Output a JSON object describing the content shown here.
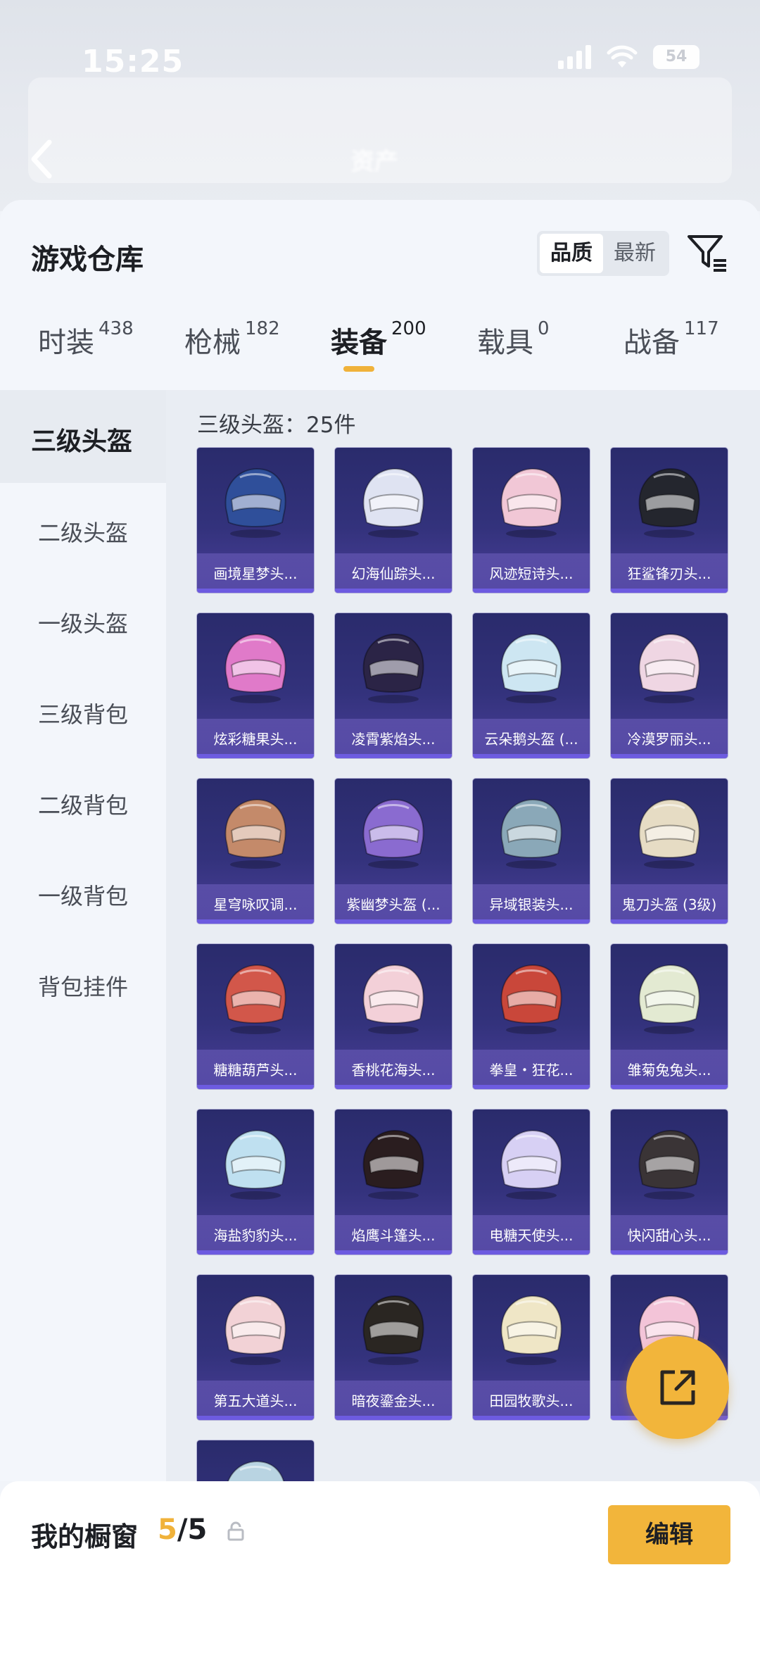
{
  "status_bar": {
    "time": "15:25",
    "battery": "54"
  },
  "backdrop": {
    "ghost_text_1": "资产"
  },
  "panel": {
    "title": "游戏仓库",
    "sort_options": [
      {
        "label": "品质",
        "active": true
      },
      {
        "label": "最新",
        "active": false
      }
    ],
    "filter_icon": "filter-funnel-icon"
  },
  "tabs": [
    {
      "label": "时装",
      "count": "438",
      "active": false
    },
    {
      "label": "枪械",
      "count": "182",
      "active": false
    },
    {
      "label": "装备",
      "count": "200",
      "active": true
    },
    {
      "label": "载具",
      "count": "0",
      "active": false
    },
    {
      "label": "战备",
      "count": "117",
      "active": false
    }
  ],
  "sidebar": {
    "items": [
      {
        "label": "三级头盔",
        "active": true
      },
      {
        "label": "二级头盔",
        "active": false
      },
      {
        "label": "一级头盔",
        "active": false
      },
      {
        "label": "三级背包",
        "active": false
      },
      {
        "label": "二级背包",
        "active": false
      },
      {
        "label": "一级背包",
        "active": false
      },
      {
        "label": "背包挂件",
        "active": false
      }
    ]
  },
  "section": {
    "title": "三级头盔：25件"
  },
  "items": [
    {
      "name": "画境星梦头...",
      "color": "#2f4f9a"
    },
    {
      "name": "幻海仙踪头...",
      "color": "#dfe3f2"
    },
    {
      "name": "风迹短诗头...",
      "color": "#f1c7d6"
    },
    {
      "name": "狂鲨锋刃头...",
      "color": "#24262e"
    },
    {
      "name": "炫彩糖果头...",
      "color": "#e07ac9"
    },
    {
      "name": "凌霄紫焰头...",
      "color": "#2b2446"
    },
    {
      "name": "云朵鹅头盔 (...",
      "color": "#cde6f2"
    },
    {
      "name": "冷漠罗丽头...",
      "color": "#efd6e3"
    },
    {
      "name": "星穹咏叹调...",
      "color": "#c48a6a"
    },
    {
      "name": "紫幽梦头盔 (...",
      "color": "#8a6bd0"
    },
    {
      "name": "异域银装头...",
      "color": "#8aa8b8"
    },
    {
      "name": "鬼刀头盔 (3级)",
      "color": "#e6dcc4"
    },
    {
      "name": "糖糖葫芦头...",
      "color": "#d2574a"
    },
    {
      "name": "香桃花海头...",
      "color": "#f3d0d8"
    },
    {
      "name": "拳皇・狂花...",
      "color": "#c9473a"
    },
    {
      "name": "雏菊兔兔头...",
      "color": "#e3ead2"
    },
    {
      "name": "海盐豹豹头...",
      "color": "#bfe0f0"
    },
    {
      "name": "焰鹰斗篷头...",
      "color": "#2a1d1f"
    },
    {
      "name": "电糖天使头...",
      "color": "#d7d0f4"
    },
    {
      "name": "快闪甜心头...",
      "color": "#3a3436"
    },
    {
      "name": "第五大道头...",
      "color": "#f2d2d6"
    },
    {
      "name": "暗夜鎏金头...",
      "color": "#2a2622"
    },
    {
      "name": "田园牧歌头...",
      "color": "#efe6c6"
    },
    {
      "name": "",
      "color": "#f3c4d8"
    },
    {
      "name": "",
      "color": "#b9d4e2"
    }
  ],
  "share_button": {
    "icon": "share-icon"
  },
  "bottom_bar": {
    "title": "我的橱窗",
    "current": "5",
    "separator": "/",
    "total": "5",
    "edit_label": "编辑",
    "accent": "#f2b53b"
  }
}
